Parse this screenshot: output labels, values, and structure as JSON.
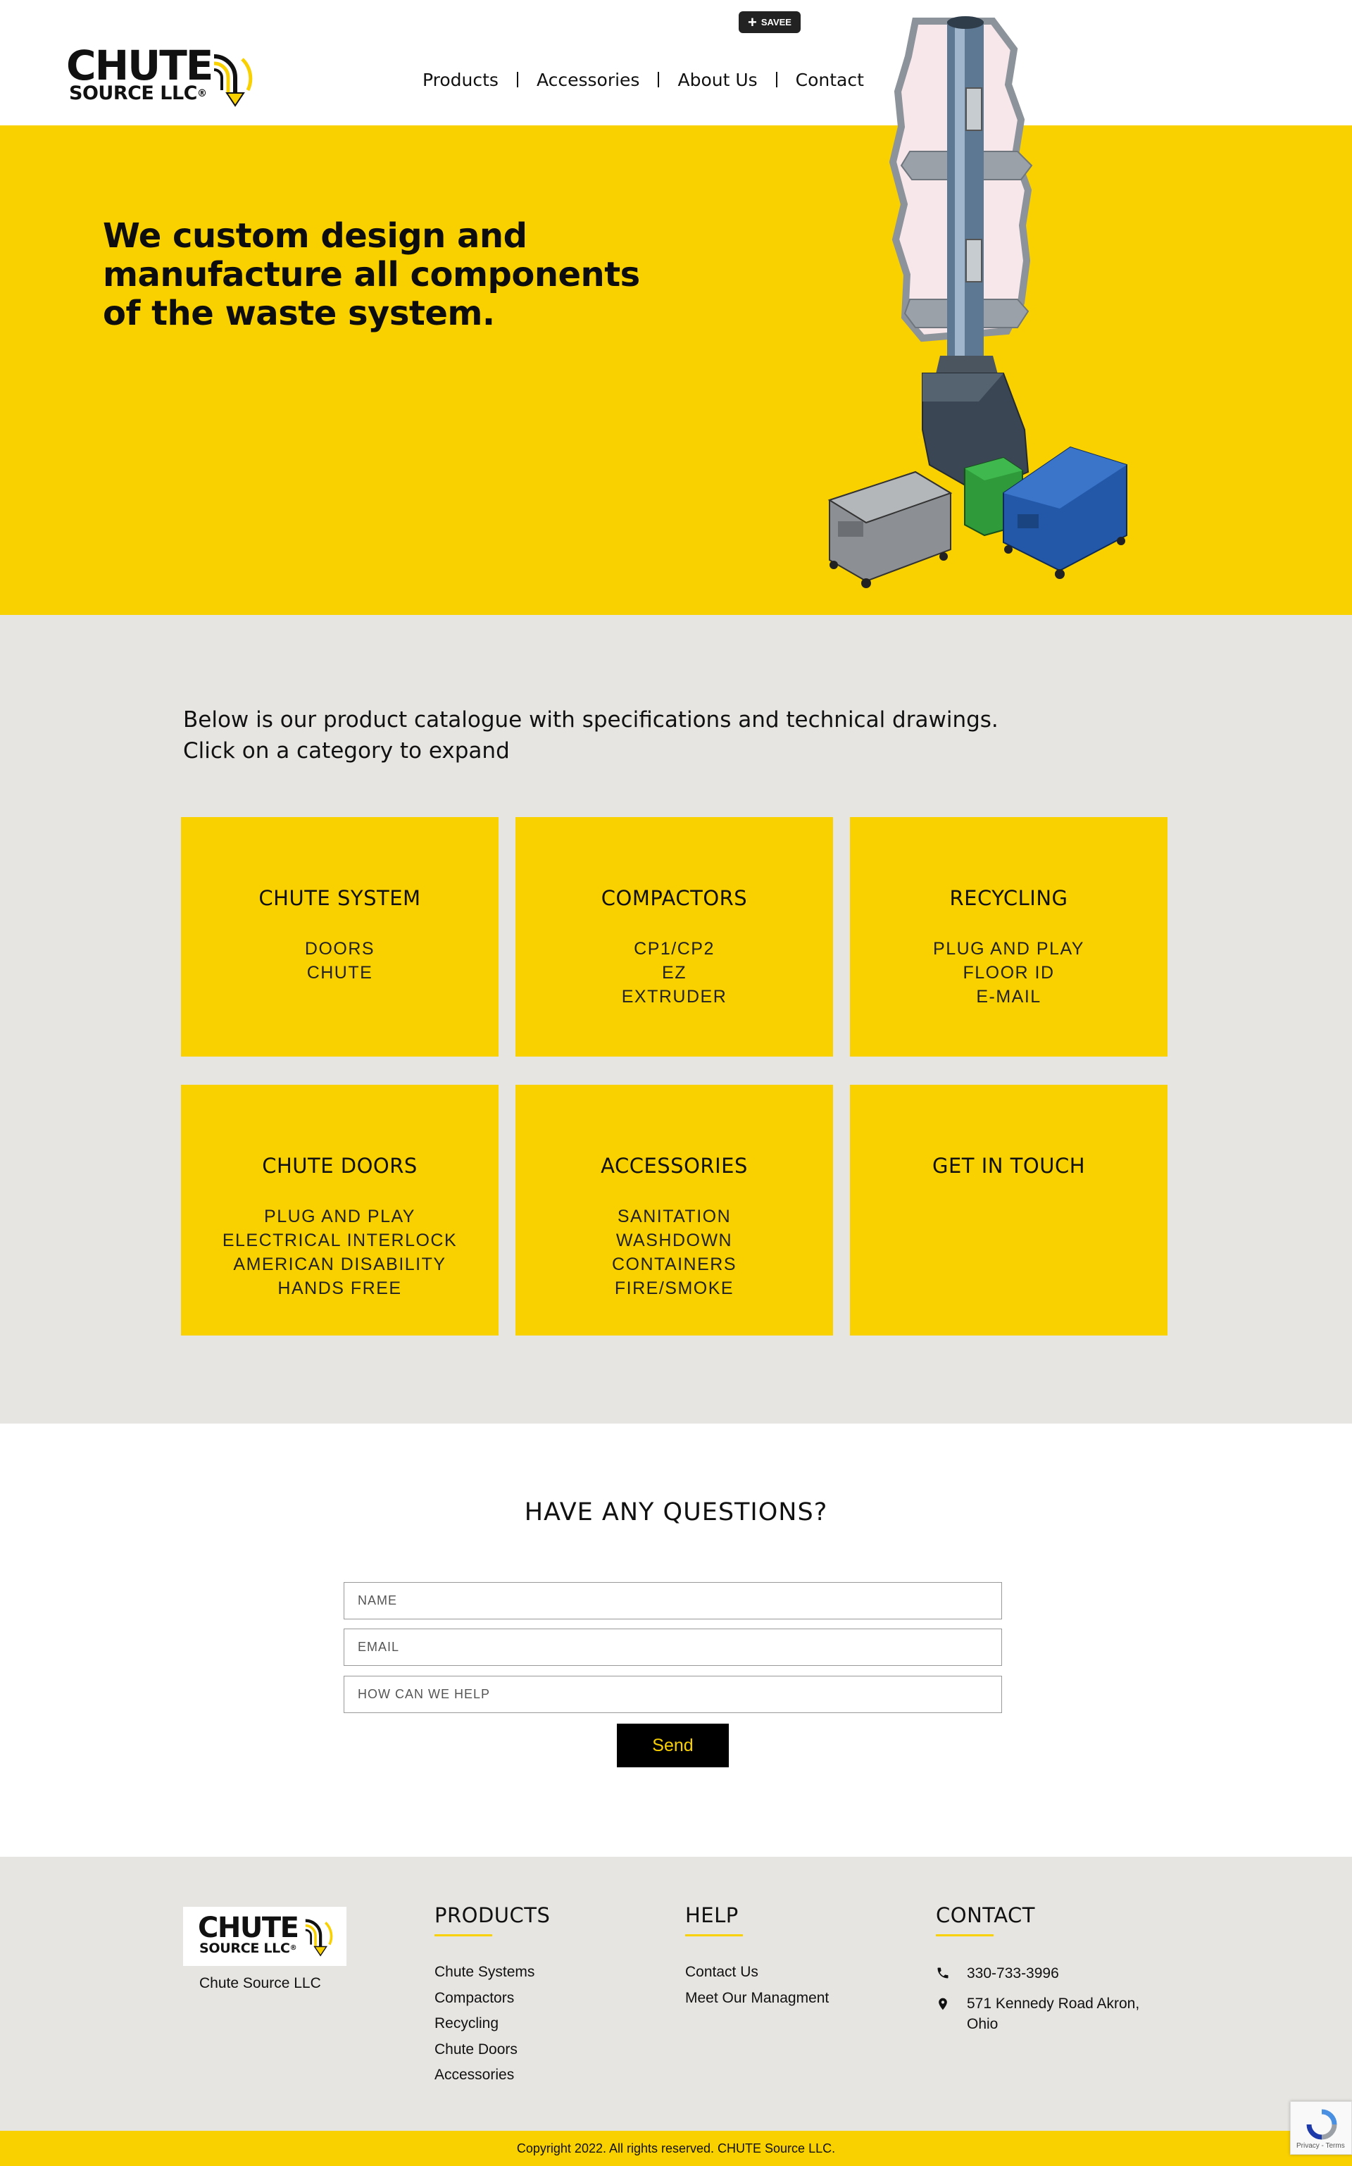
{
  "brand": {
    "logo_big": "CHUTE",
    "logo_small": "SOURCE LLC",
    "logo_reg": "®",
    "accent": "#F9D000",
    "background_gray": "#E7E5E1"
  },
  "save_button": {
    "icon": "plus-icon",
    "label": "SAVEE"
  },
  "nav": {
    "items": [
      "Products",
      "Accessories",
      "About Us",
      "Contact"
    ]
  },
  "hero": {
    "headline": "We custom design and manufacture all components of the waste system.",
    "illustration": "chute-system-illustration"
  },
  "catalogue": {
    "intro_line1": "Below is our product catalogue with specifications and technical drawings.",
    "intro_line2": "Click on a category to expand",
    "categories": [
      {
        "title": "CHUTE SYSTEM",
        "items": [
          "DOORS",
          "CHUTE"
        ]
      },
      {
        "title": "COMPACTORS",
        "items": [
          "CP1/CP2",
          "EZ",
          "EXTRUDER"
        ]
      },
      {
        "title": "RECYCLING",
        "items": [
          "PLUG AND PLAY",
          "FLOOR ID",
          "E-MAIL"
        ]
      },
      {
        "title": "CHUTE DOORS",
        "items": [
          "PLUG AND PLAY",
          "ELECTRICAL INTERLOCK",
          "AMERICAN DISABILITY",
          "HANDS FREE"
        ]
      },
      {
        "title": "ACCESSORIES",
        "items": [
          "SANITATION",
          "WASHDOWN",
          "CONTAINERS",
          "FIRE/SMOKE"
        ]
      },
      {
        "title": "GET IN TOUCH",
        "items": []
      }
    ]
  },
  "questions": {
    "heading": "HAVE ANY QUESTIONS?",
    "name_placeholder": "NAME",
    "email_placeholder": "EMAIL",
    "help_placeholder": "HOW CAN WE HELP",
    "send_label": "Send"
  },
  "footer": {
    "company_name": "Chute Source LLC",
    "products": {
      "heading": "PRODUCTS",
      "links": [
        "Chute Systems",
        "Compactors",
        "Recycling",
        "Chute Doors",
        "Accessories"
      ]
    },
    "help": {
      "heading": "HELP",
      "links": [
        "Contact Us",
        "Meet Our Managment"
      ]
    },
    "contact": {
      "heading": "CONTACT",
      "phone": "330-733-3996",
      "address_line1": "571 Kennedy Road Akron,",
      "address_line2": "Ohio"
    },
    "copyright": "Copyright 2022. All rights reserved. CHUTE Source LLC.",
    "recaptcha_text": "Privacy - Terms"
  }
}
